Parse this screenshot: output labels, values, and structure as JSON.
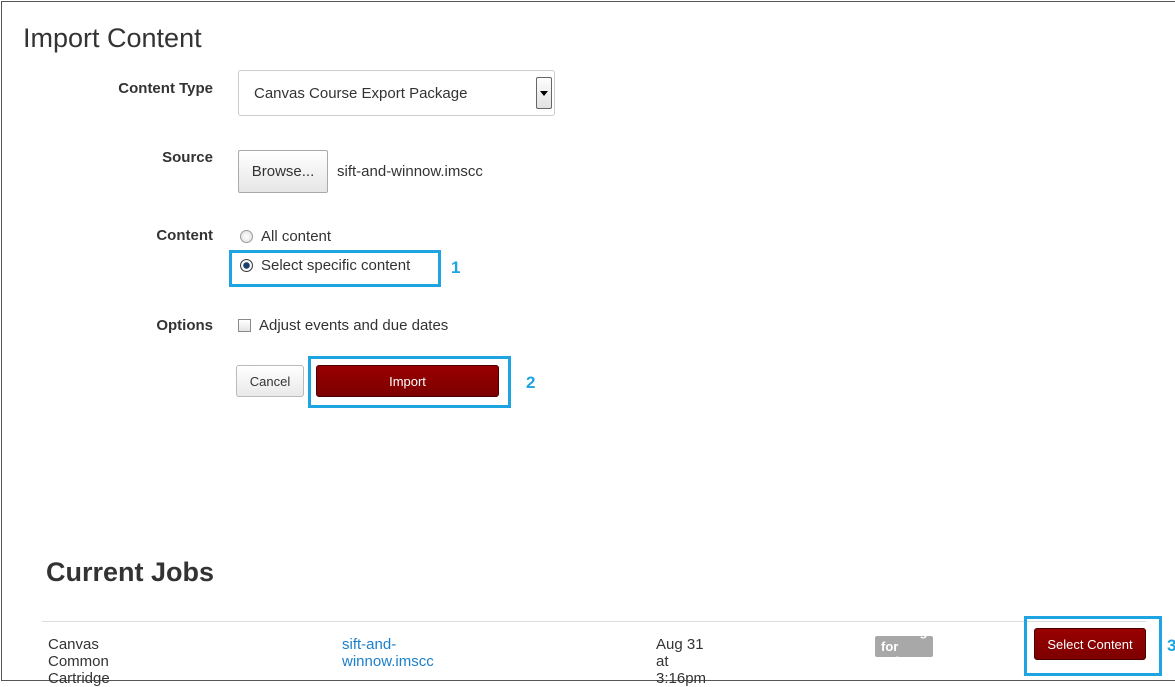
{
  "page": {
    "title": "Import Content"
  },
  "form": {
    "content_type": {
      "label": "Content Type",
      "selected": "Canvas Course Export Package"
    },
    "source": {
      "label": "Source",
      "browse_label": "Browse...",
      "file_name": "sift-and-winnow.imscc"
    },
    "content": {
      "label": "Content",
      "options": [
        {
          "label": "All content",
          "checked": false
        },
        {
          "label": "Select specific content",
          "checked": true
        }
      ]
    },
    "options": {
      "label": "Options",
      "items": [
        {
          "label": "Adjust events and due dates",
          "checked": false
        }
      ]
    },
    "cancel_label": "Cancel",
    "import_label": "Import"
  },
  "callouts": [
    "1",
    "2",
    "3"
  ],
  "jobs": {
    "heading": "Current Jobs",
    "rows": [
      {
        "type": "Canvas Common Cartridge",
        "file": "sift-and-winnow.imscc",
        "date": "Aug 31 at 3:16pm",
        "status": "Waiting for select",
        "action_label": "Select Content"
      }
    ]
  },
  "colors": {
    "accent": "#990000",
    "highlight": "#1ea4e0",
    "link": "#1b7fcc",
    "badge": "#a8a8a8"
  }
}
